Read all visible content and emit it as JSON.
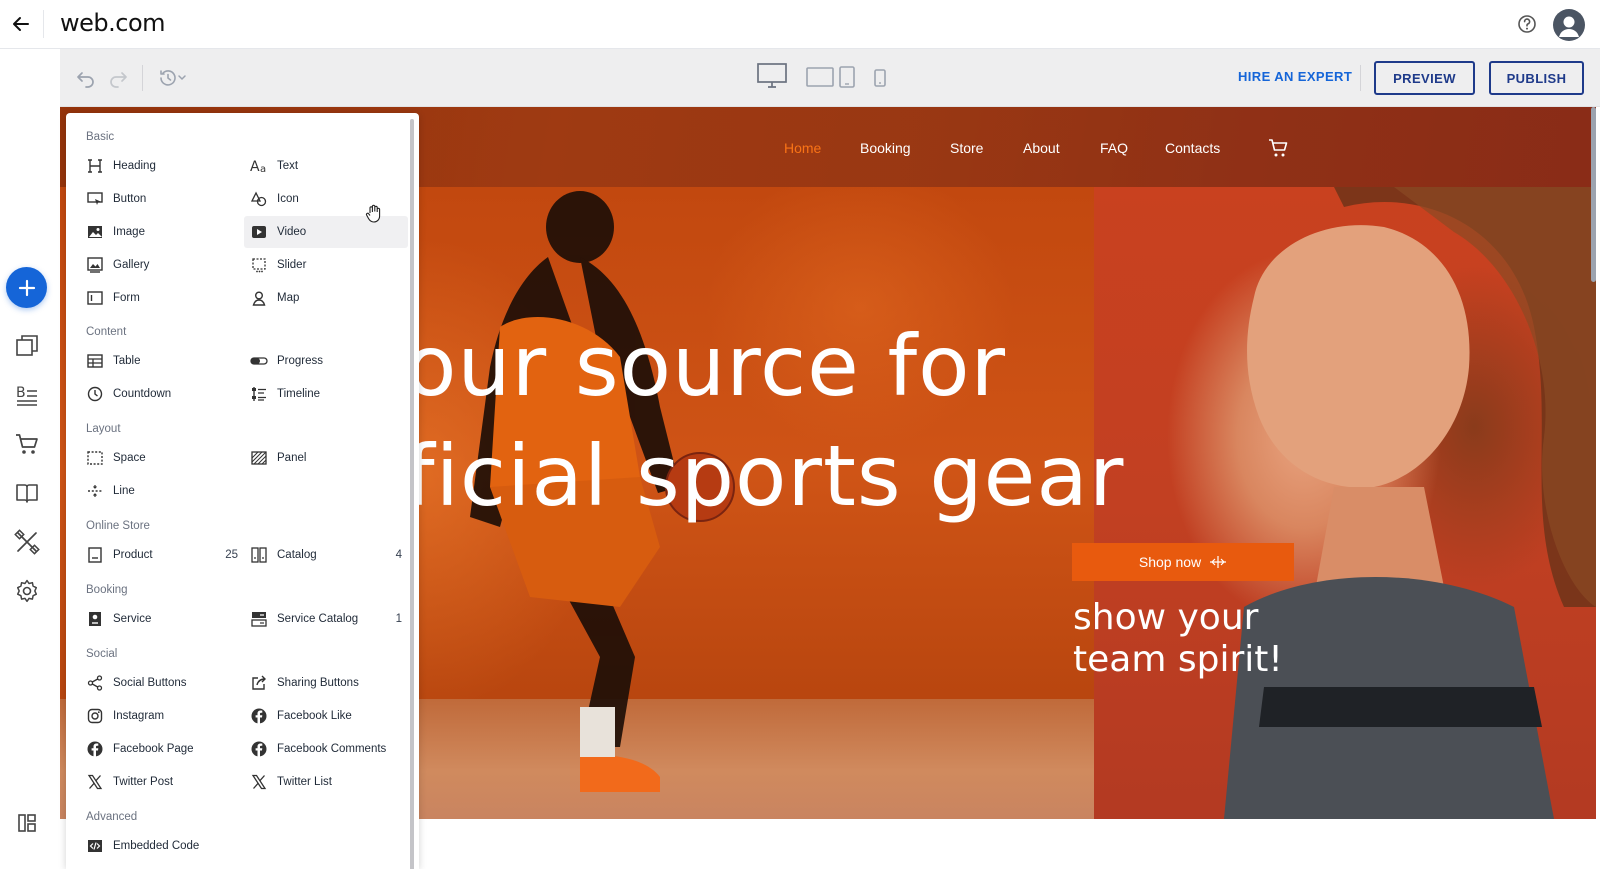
{
  "app": {
    "logo": "web.com"
  },
  "toolbar": {
    "hire_label": "HIRE AN EXPERT",
    "preview_label": "PREVIEW",
    "publish_label": "PUBLISH"
  },
  "site": {
    "nav": [
      "Home",
      "Booking",
      "Store",
      "About",
      "FAQ",
      "Contacts"
    ],
    "active_nav": "Home",
    "hero_line1": "our source for",
    "hero_line2": "ficial sports gear",
    "shop_label": "Shop now",
    "tagline_line1": "show your",
    "tagline_line2": "team spirit!"
  },
  "panel": {
    "sections": [
      {
        "title": "Basic",
        "items": [
          {
            "label": "Heading",
            "icon": "heading-icon"
          },
          {
            "label": "Text",
            "icon": "text-icon"
          },
          {
            "label": "Button",
            "icon": "button-icon"
          },
          {
            "label": "Icon",
            "icon": "shapes-icon"
          },
          {
            "label": "Image",
            "icon": "image-icon"
          },
          {
            "label": "Video",
            "icon": "video-icon"
          },
          {
            "label": "Gallery",
            "icon": "gallery-icon"
          },
          {
            "label": "Slider",
            "icon": "slider-icon"
          },
          {
            "label": "Form",
            "icon": "form-icon"
          },
          {
            "label": "Map",
            "icon": "map-pin-icon"
          }
        ]
      },
      {
        "title": "Content",
        "items": [
          {
            "label": "Table",
            "icon": "table-icon"
          },
          {
            "label": "Progress",
            "icon": "progress-icon"
          },
          {
            "label": "Countdown",
            "icon": "countdown-icon"
          },
          {
            "label": "Timeline",
            "icon": "timeline-icon"
          }
        ]
      },
      {
        "title": "Layout",
        "items": [
          {
            "label": "Space",
            "icon": "space-icon"
          },
          {
            "label": "Panel",
            "icon": "panel-icon"
          },
          {
            "label": "Line",
            "icon": "line-icon"
          }
        ]
      },
      {
        "title": "Online Store",
        "items": [
          {
            "label": "Product",
            "icon": "product-icon",
            "count": "25"
          },
          {
            "label": "Catalog",
            "icon": "catalog-icon",
            "count": "4"
          }
        ]
      },
      {
        "title": "Booking",
        "items": [
          {
            "label": "Service",
            "icon": "service-icon"
          },
          {
            "label": "Service Catalog",
            "icon": "service-catalog-icon",
            "count": "1"
          }
        ]
      },
      {
        "title": "Social",
        "items": [
          {
            "label": "Social Buttons",
            "icon": "share-nodes-icon"
          },
          {
            "label": "Sharing Buttons",
            "icon": "share-out-icon"
          },
          {
            "label": "Instagram",
            "icon": "instagram-icon"
          },
          {
            "label": "Facebook Like",
            "icon": "facebook-icon"
          },
          {
            "label": "Facebook Page",
            "icon": "facebook-icon"
          },
          {
            "label": "Facebook Comments",
            "icon": "facebook-icon"
          },
          {
            "label": "Twitter Post",
            "icon": "x-logo-icon"
          },
          {
            "label": "Twitter List",
            "icon": "x-logo-icon"
          }
        ]
      },
      {
        "title": "Advanced",
        "items": [
          {
            "label": "Embedded Code",
            "icon": "code-icon"
          }
        ]
      }
    ],
    "hovered_item": "Video"
  }
}
